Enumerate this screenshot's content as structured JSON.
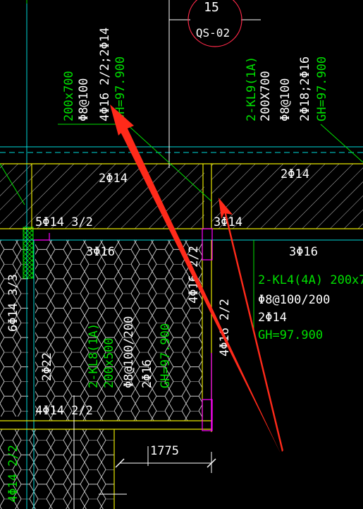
{
  "colors": {
    "background": "#000000",
    "white": "#ffffff",
    "green": "#00e000",
    "yellow": "#e6e600",
    "cyan": "#00d8d8",
    "magenta": "#ff00ff",
    "red_arrow": "#ff2a1a",
    "hatch": "#c8c8c8",
    "honeycomb": "#cfcfcf"
  },
  "section_marker": {
    "number": "15",
    "ref": "QS-02"
  },
  "beam_labels": {
    "kl_left_top": {
      "size": "200x700",
      "stirrup": "Φ8@100",
      "bars": "4Φ16 2/2;2Φ14",
      "gh": "GH=97.900"
    },
    "kl9": {
      "id": "2-KL9(1A)",
      "size": "200X700",
      "stirrup": "Φ8@100",
      "bars": "2Φ18;2Φ16",
      "gh": "GH=97.900"
    },
    "kl4": {
      "id": "2-KL4(4A) 200x7",
      "stirrup": "Φ8@100/200",
      "bars": "2Φ14",
      "gh": "GH=97.900"
    },
    "kl8": {
      "id": "2-KL8(1A)",
      "size": "200x500",
      "stirrup": "Φ8@100/200",
      "bars": "2Φ16",
      "gh": "GH=97.900"
    }
  },
  "rebar_texts": {
    "top_left_2phi14": "2Φ14",
    "top_right_2phi14": "2Φ14",
    "left_5phi14": "5Φ14 3/2",
    "mid_3phi14": "3Φ14",
    "mid_3phi16": "3Φ16",
    "right_3phi16": "3Φ16",
    "vert_4phi16_a": "4Φ16 2/2",
    "vert_4phi16_b": "4Φ16 2/2",
    "left_6phi14": "6Φ14 3/3",
    "left_2phi22": "2Φ22",
    "bottom_4phi14": "4Φ14 2/2",
    "far_left_bottom": "4Φ14 2/2"
  },
  "dimension": {
    "value": "1775"
  }
}
